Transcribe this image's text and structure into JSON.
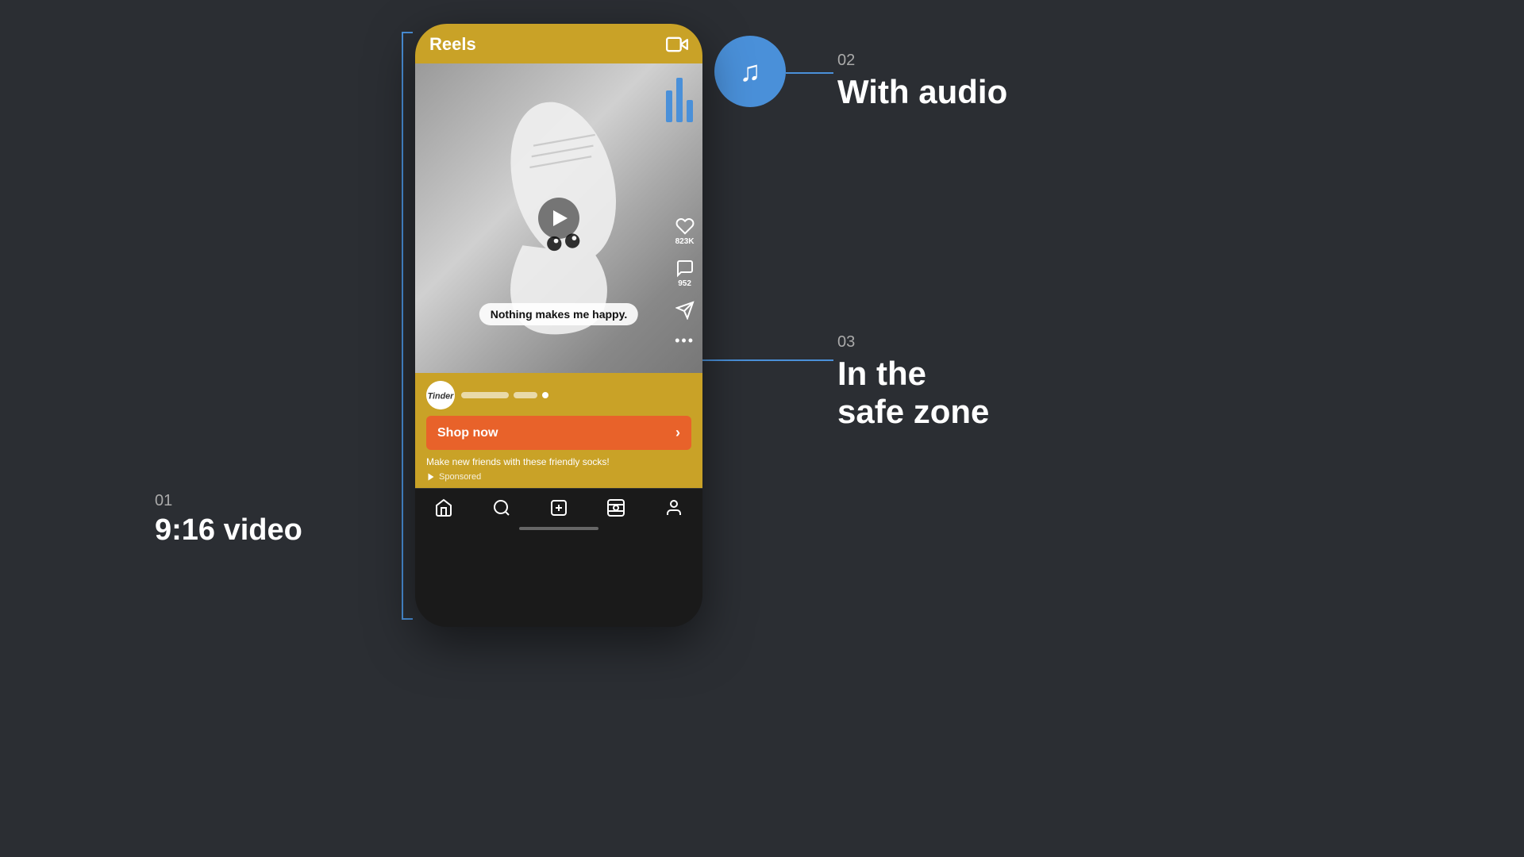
{
  "page": {
    "background": "#2b2e33"
  },
  "annotations": {
    "ann01": {
      "num": "01",
      "label": "9:16 video"
    },
    "ann02": {
      "num": "02",
      "label": "With audio"
    },
    "ann03": {
      "num": "03",
      "label": "In the safe zone"
    }
  },
  "phone": {
    "header": {
      "title": "Reels"
    },
    "video": {
      "caption": "Nothing makes me happy."
    },
    "actions": {
      "likes": "823K",
      "comments": "952"
    },
    "cta": {
      "button_label": "Shop now",
      "description": "Make new friends with these friendly socks!",
      "sponsored": "Sponsored"
    },
    "nav": {
      "items": [
        "🏠",
        "🔍",
        "➕",
        "📺",
        "👤"
      ]
    }
  }
}
